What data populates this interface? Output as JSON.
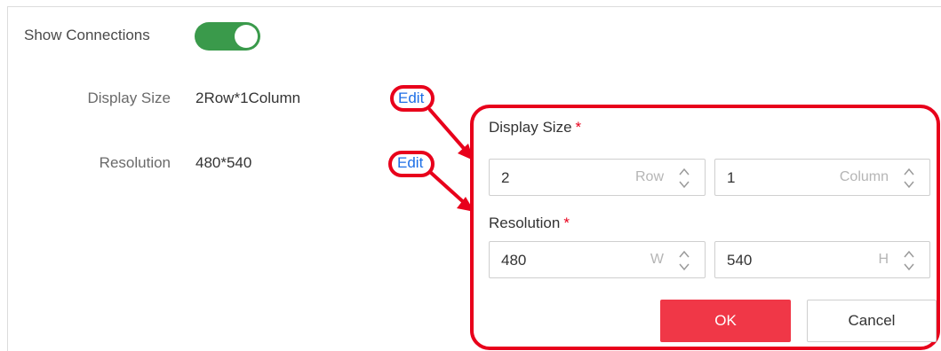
{
  "settings": {
    "show_connections_label": "Show Connections",
    "show_connections_on": true,
    "display_size_label": "Display Size",
    "display_size_value": "2Row*1Column",
    "resolution_label": "Resolution",
    "resolution_value": "480*540",
    "edit_label": "Edit"
  },
  "edit_panel": {
    "display_size_title": "Display Size",
    "resolution_title": "Resolution",
    "required_mark": "*",
    "rows_value": "2",
    "rows_unit": "Row",
    "columns_value": "1",
    "columns_unit": "Column",
    "width_value": "480",
    "width_unit": "W",
    "height_value": "540",
    "height_unit": "H",
    "ok_label": "OK",
    "cancel_label": "Cancel"
  },
  "colors": {
    "toggle_on": "#3a9a4b",
    "link": "#1c6ee6",
    "highlight": "#e8001b",
    "ok_button": "#f03747"
  },
  "icons": [
    "up-down-spinner-icon",
    "annotation-arrow"
  ]
}
